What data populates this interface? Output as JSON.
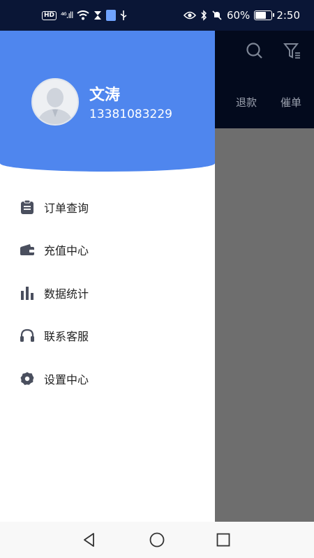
{
  "status_bar": {
    "hd_badge": "HD",
    "signal": "⁴⁶.ıll",
    "battery_percent": "60%",
    "battery_level": 0.6,
    "time": "2:50",
    "icons": [
      "wifi-icon",
      "hourglass-icon",
      "app-notification-icon",
      "usb-icon",
      "eye-icon",
      "bluetooth-icon",
      "mute-icon",
      "battery-icon"
    ]
  },
  "background_app": {
    "icons": [
      "search-icon",
      "filter-icon"
    ],
    "tabs": [
      "退款",
      "催单"
    ]
  },
  "drawer": {
    "user": {
      "name": "文涛",
      "phone": "13381083229"
    },
    "menu": [
      {
        "label": "订单查询",
        "icon": "clipboard-icon"
      },
      {
        "label": "充值中心",
        "icon": "wallet-icon"
      },
      {
        "label": "数据统计",
        "icon": "bar-chart-icon"
      },
      {
        "label": "联系客服",
        "icon": "headset-icon"
      },
      {
        "label": "设置中心",
        "icon": "settings-gear-icon"
      }
    ]
  },
  "nav_bar": {
    "icons": [
      "back-icon",
      "home-icon",
      "recents-icon"
    ]
  },
  "colors": {
    "header_blue": "#4f86ee",
    "status_bar": "#0a1636",
    "icon_gray": "#4a4f5e",
    "scrim": "#6e6e6e"
  }
}
